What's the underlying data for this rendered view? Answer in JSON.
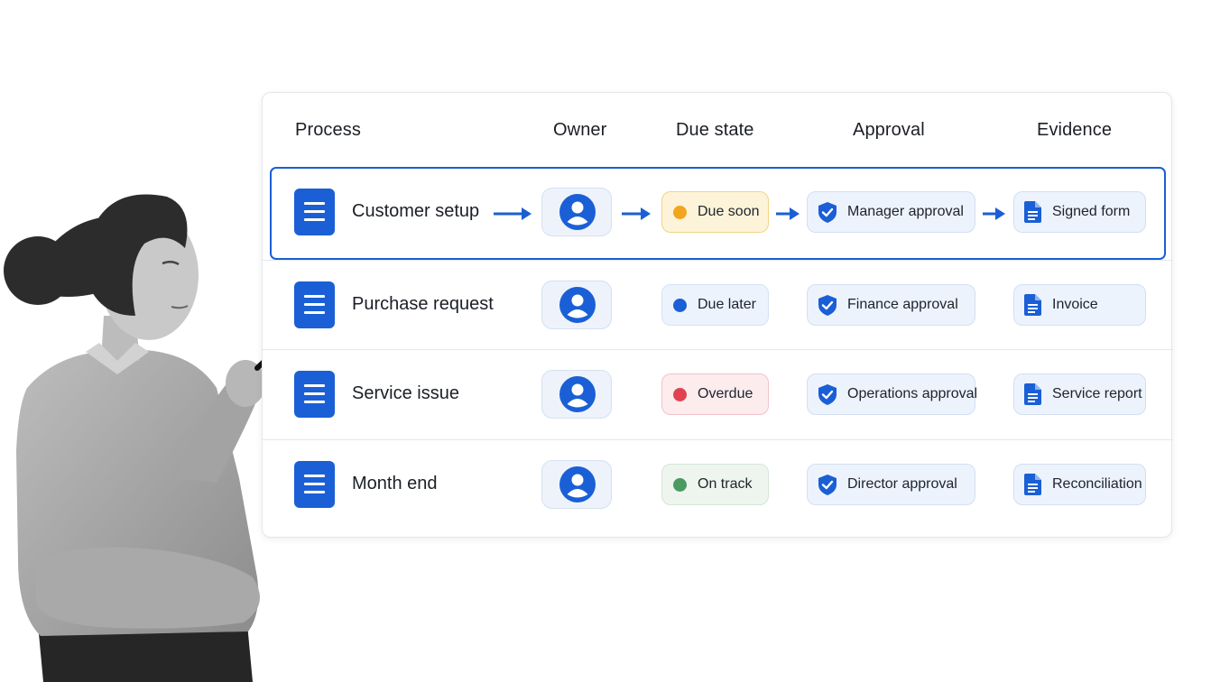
{
  "table": {
    "headers": {
      "process": "Process",
      "owner": "Owner",
      "due_state": "Due state",
      "approval": "Approval",
      "evidence": "Evidence"
    },
    "rows": [
      {
        "process": "Customer setup",
        "due": "Due soon",
        "due_color": "#f2a51e",
        "approval": "Manager approval",
        "evidence": "Signed form",
        "selected": true
      },
      {
        "process": "Purchase request",
        "due": "Due later",
        "due_color": "#1a5fd6",
        "approval": "Finance approval",
        "evidence": "Invoice",
        "selected": false
      },
      {
        "process": "Service issue",
        "due": "Overdue",
        "due_color": "#e0434f",
        "approval": "Operations approval",
        "evidence": "Service report",
        "selected": false
      },
      {
        "process": "Month end",
        "due": "On track",
        "due_color": "#4b9a62",
        "approval": "Director approval",
        "evidence": "Reconciliation",
        "selected": false
      }
    ]
  },
  "colors": {
    "accent": "#1a5fd6",
    "chip_bg": "#edf3fc"
  },
  "icons": {
    "process": "document-lines-icon",
    "owner": "user-avatar-icon",
    "approval": "shield-check-icon",
    "evidence": "file-icon",
    "flow": "arrow-right-icon"
  }
}
